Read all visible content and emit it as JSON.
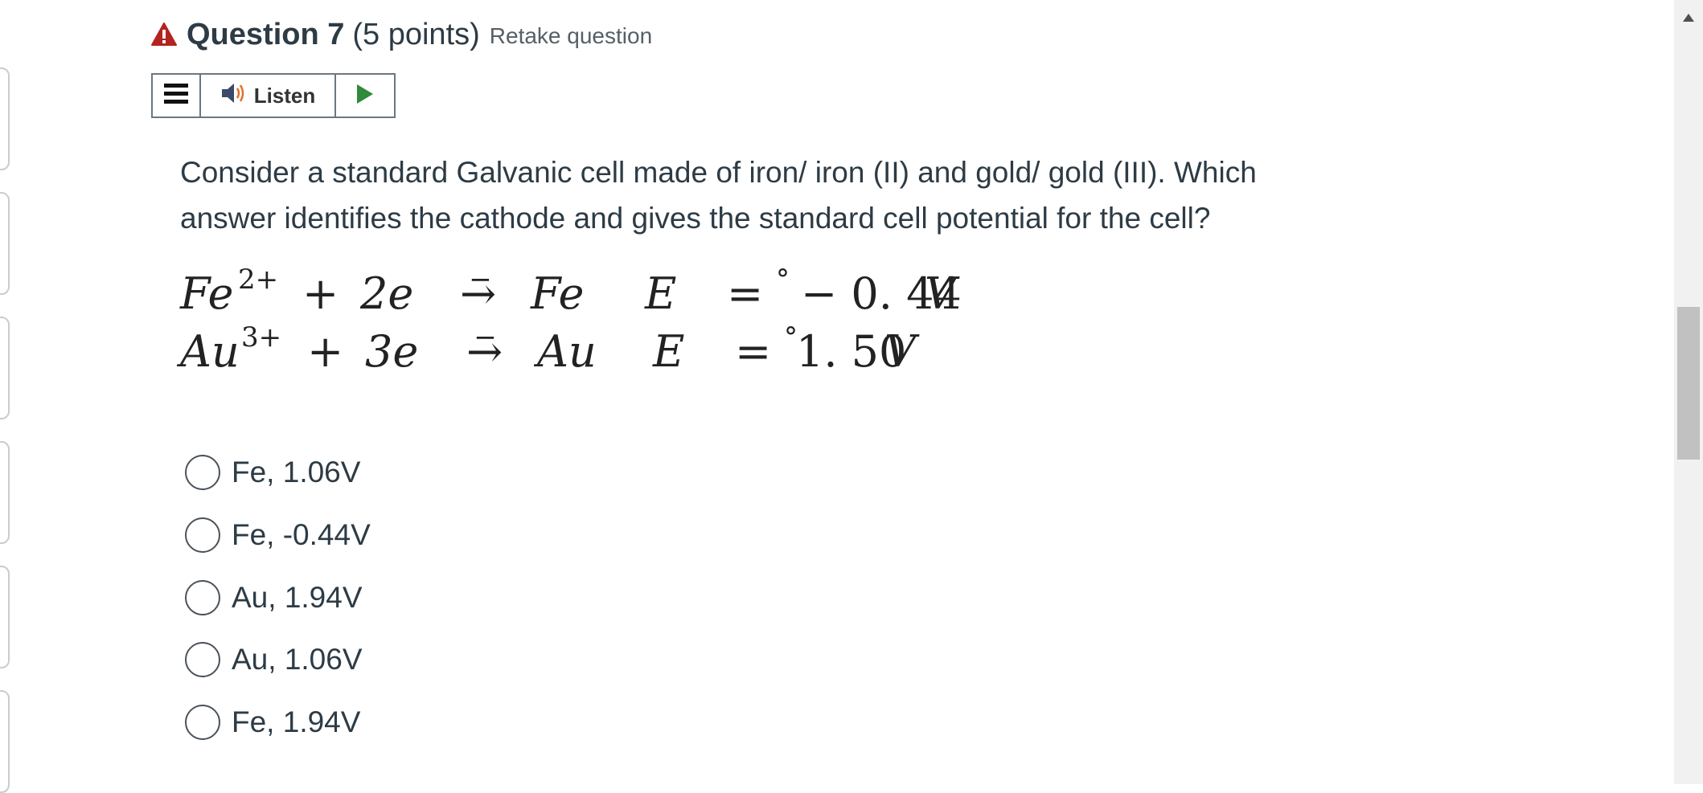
{
  "question": {
    "title": "Question 7",
    "points": "(5 points)",
    "retake_label": "Retake question",
    "text": "Consider a standard Galvanic cell made of iron/ iron (II) and gold/ gold (III).  Which answer identifies the cathode and gives the standard cell potential for the cell?"
  },
  "toolbar": {
    "menu_icon": "hamburger-icon",
    "listen_label": "Listen",
    "speaker_icon": "speaker-icon",
    "play_icon": "play-icon"
  },
  "equations": [
    {
      "ion": "Fe",
      "charge": "2+",
      "plus": "+",
      "electrons": "2e",
      "electron_charge": "−",
      "arrow": "→",
      "product": "Fe",
      "E": "E",
      "degree": "°",
      "eq": "=",
      "value": "− 0. 44",
      "unit": "V"
    },
    {
      "ion": "Au",
      "charge": "3+",
      "plus": "+",
      "electrons": "3e",
      "electron_charge": "−",
      "arrow": "→",
      "product": "Au",
      "E": "E",
      "degree": "°",
      "eq": "=",
      "value": "1. 50",
      "unit": "V"
    }
  ],
  "answers": [
    {
      "label": "Fe, 1.06V",
      "selected": false
    },
    {
      "label": "Fe, -0.44V",
      "selected": false
    },
    {
      "label": "Au, 1.94V",
      "selected": false
    },
    {
      "label": "Au, 1.06V",
      "selected": false
    },
    {
      "label": "Fe, 1.94V",
      "selected": false
    }
  ],
  "colors": {
    "warning": "#b3231f",
    "play": "#2e8b3a",
    "speaker": "#3b4a6b",
    "speaker_waves": "#e0712c"
  }
}
